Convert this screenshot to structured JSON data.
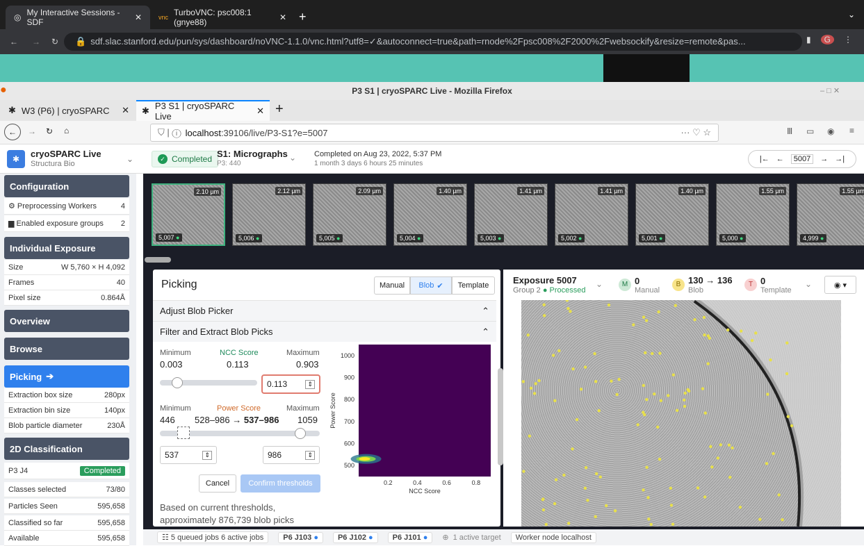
{
  "chrome": {
    "tabs": [
      {
        "label": "My Interactive Sessions - SDF"
      },
      {
        "label": "TurboVNC: psc008:1 (gnye88)"
      }
    ],
    "url": "sdf.slac.stanford.edu/pun/sys/dashboard/noVNC-1.1.0/vnc.html?utf8=✓&autoconnect=true&path=rnode%2Fpsc008%2F2000%2Fwebsockify&resize=remote&pas..."
  },
  "firefox": {
    "title": "P3 S1 | cryoSPARC Live - Mozilla Firefox",
    "tabs": [
      {
        "label": "W3 (P6) | cryoSPARC"
      },
      {
        "label": "P3 S1 | cryoSPARC Live"
      }
    ],
    "url_host": "localhost",
    "url_rest": ":39106/live/P3-S1?e=5007"
  },
  "header": {
    "app_name": "cryoSPARC Live",
    "org": "Structura Bio",
    "status": "Completed",
    "session_title": "S1: Micrographs",
    "session_sub": "P3: 440",
    "completed_on": "Completed on Aug 23, 2022, 5:37 PM",
    "completed_ago": "1 month 3 days 6 hours 25 minutes",
    "exposure_num": "5007"
  },
  "sidebar": {
    "configuration": "Configuration",
    "preproc": {
      "label": "Preprocessing Workers",
      "value": "4"
    },
    "groups": {
      "label": "Enabled exposure groups",
      "value": "2"
    },
    "individual": "Individual Exposure",
    "size": {
      "label": "Size",
      "value": "W 5,760 × H 4,092"
    },
    "frames": {
      "label": "Frames",
      "value": "40"
    },
    "pixel": {
      "label": "Pixel size",
      "value": "0.864Å"
    },
    "overview": "Overview",
    "browse": "Browse",
    "picking": "Picking",
    "box": {
      "label": "Extraction box size",
      "value": "280px"
    },
    "bin": {
      "label": "Extraction bin size",
      "value": "140px"
    },
    "diam": {
      "label": "Blob particle diameter",
      "value": "230Å"
    },
    "class2d": "2D Classification",
    "job": {
      "label": "P3 J4",
      "value": "Completed"
    },
    "classes": {
      "label": "Classes selected",
      "value": "73/80"
    },
    "seen": {
      "label": "Particles Seen",
      "value": "595,658"
    },
    "classified": {
      "label": "Classified so far",
      "value": "595,658"
    },
    "available": {
      "label": "Available",
      "value": "595,658"
    }
  },
  "thumbs": [
    {
      "um": "2.10 µm",
      "num": "5,007"
    },
    {
      "um": "2.12 µm",
      "num": "5,006"
    },
    {
      "um": "2.09 µm",
      "num": "5,005"
    },
    {
      "um": "1.40 µm",
      "num": "5,004"
    },
    {
      "um": "1.41 µm",
      "num": "5,003"
    },
    {
      "um": "1.41 µm",
      "num": "5,002"
    },
    {
      "um": "1.40 µm",
      "num": "5,001"
    },
    {
      "um": "1.55 µm",
      "num": "5,000"
    },
    {
      "um": "1.55 µm",
      "num": "4,999"
    }
  ],
  "picking": {
    "title": "Picking",
    "manual": "Manual",
    "blob": "Blob",
    "template": "Template",
    "adjust": "Adjust Blob Picker",
    "filter": "Filter and Extract Blob Picks",
    "ncc": {
      "min_label": "Minimum",
      "title": "NCC Score",
      "max_label": "Maximum",
      "min": "0.003",
      "mid": "0.113",
      "max": "0.903",
      "input": "0.113",
      "slider_frac": 0.12
    },
    "power": {
      "min_label": "Minimum",
      "title": "Power Score",
      "max_label": "Maximum",
      "min": "446",
      "range": "528–986 → ",
      "range_bold": "537–986",
      "max": "1059",
      "low": "537",
      "high": "986"
    },
    "cancel": "Cancel",
    "confirm": "Confirm thresholds",
    "note": "Based on current thresholds, approximately 876,739 blob picks"
  },
  "chart_data": {
    "type": "heatmap",
    "xlabel": "NCC Score",
    "ylabel": "Power Score",
    "xticks": [
      "0.2",
      "0.4",
      "0.6",
      "0.8"
    ],
    "yticks": [
      "1000",
      "900",
      "800",
      "700",
      "600",
      "500"
    ],
    "xlim": [
      0,
      0.9
    ],
    "ylim": [
      450,
      1050
    ],
    "hotspot": {
      "x": 0.05,
      "y": 530
    }
  },
  "exposure": {
    "title": "Exposure 5007",
    "group": "Group 2",
    "processed": "Processed",
    "manual_count": "0",
    "manual_label": "Manual",
    "blob_count": "130 → 136",
    "blob_label": "Blob",
    "template_count": "0",
    "template_label": "Template"
  },
  "status": {
    "queued": "5 queued jobs",
    "active": "6 active jobs",
    "j103": "P6 J103",
    "j102": "P6 J102",
    "j101": "P6 J101",
    "target": "1 active target",
    "worker": "Worker node localhost"
  }
}
